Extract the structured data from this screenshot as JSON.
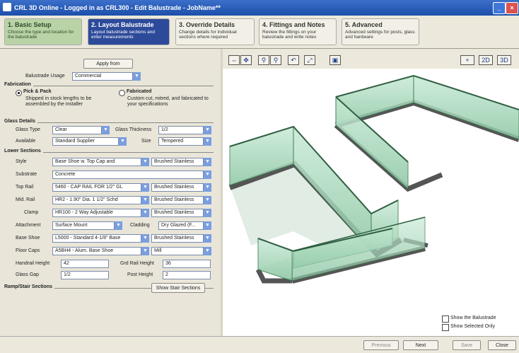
{
  "window": {
    "title": "CRL 3D Online - Logged in as CRL300 - Edit Balustrade - JobName**"
  },
  "steps": [
    {
      "title": "1. Basic Setup",
      "desc": "Choose the type and location for the balustrade"
    },
    {
      "title": "2. Layout Balustrade",
      "desc": "Layout balustrade sections and enter measurements"
    },
    {
      "title": "3. Override Details",
      "desc": "Change details for individual sections where required"
    },
    {
      "title": "4. Fittings and Notes",
      "desc": "Review the fittings on your balustrade and write notes"
    },
    {
      "title": "5. Advanced",
      "desc": "Advanced settings for posts, glass and hardware"
    }
  ],
  "form": {
    "apply_from": "Apply from",
    "usage_label": "Balustrade Usage",
    "usage_value": "Commercial",
    "fabrication_title": "Fabrication",
    "pick_pack_label": "Pick & Pack",
    "pick_pack_desc": "Shipped in stock lengths to be assembled by the installer",
    "fabricated_label": "Fabricated",
    "fabricated_desc": "Custom cut, mitred, and fabricated to your specifications",
    "glass_title": "Glass Details",
    "glass_type_label": "Glass Type",
    "glass_type_value": "Clear",
    "glass_thickness_label": "Glass Thickness",
    "glass_thickness_value": "1/2",
    "avail_label": "Available",
    "avail_value": "Standard Supplier",
    "size_label": "Size",
    "size_value": "Tempered",
    "sections_title": "Lower Sections",
    "style_label": "Style",
    "style_value": "Base Shoe w. Top Cap and",
    "style_finish": "Brushed Stainless",
    "substrate_label": "Substrate",
    "substrate_value": "Concrete",
    "toprail_label": "Top Rail",
    "toprail_value": "5460 - CAP RAIL FOR 1/2\" GL",
    "toprail_finish": "Brushed Stainless",
    "mid_label": "Mid. Rail",
    "mid_value": "HR2 - 1.90\" Dia. 1 1/2\" Schd",
    "mid_finish": "Brushed Stainless",
    "clamp_label": "Clamp",
    "clamp_value": "HR100 - 2 Way Adjustable",
    "clamp_finish": "Brushed Stainless",
    "attach_label": "Attachment",
    "attach_value": "Surface Mount",
    "cladding_label": "Cladding",
    "cladding_value": "Dry Glazed (F...",
    "baseshoe_label": "Base Shoe",
    "baseshoe_value": "L5000 - Standard 4-1/8\" Base",
    "baseshoe_finish": "Brushed Stainless",
    "endcaps_label": "Floor Caps",
    "endcaps_value": "A5BH4 - Alum. Base Shoe",
    "endcaps_finish": "Mill",
    "handrail_h_label": "Handrail Height",
    "handrail_h_value": "42",
    "rail_h_label": "Grd Rail Height",
    "rail_h_value": "36",
    "glass_gap_label": "Glass Gap",
    "glass_gap_value": "1/2",
    "post_h_label": "Post Height",
    "post_h_value": "2",
    "ramp_title": "Ramp/Stair Sections",
    "ramp_button": "Show Stair Sections"
  },
  "viewport": {
    "opt_sample": "Show the Balustrade",
    "opt_selected": "Show Selected Only"
  },
  "bottom": {
    "previous": "Previous",
    "next": "Next",
    "save": "Save",
    "close": "Close"
  }
}
